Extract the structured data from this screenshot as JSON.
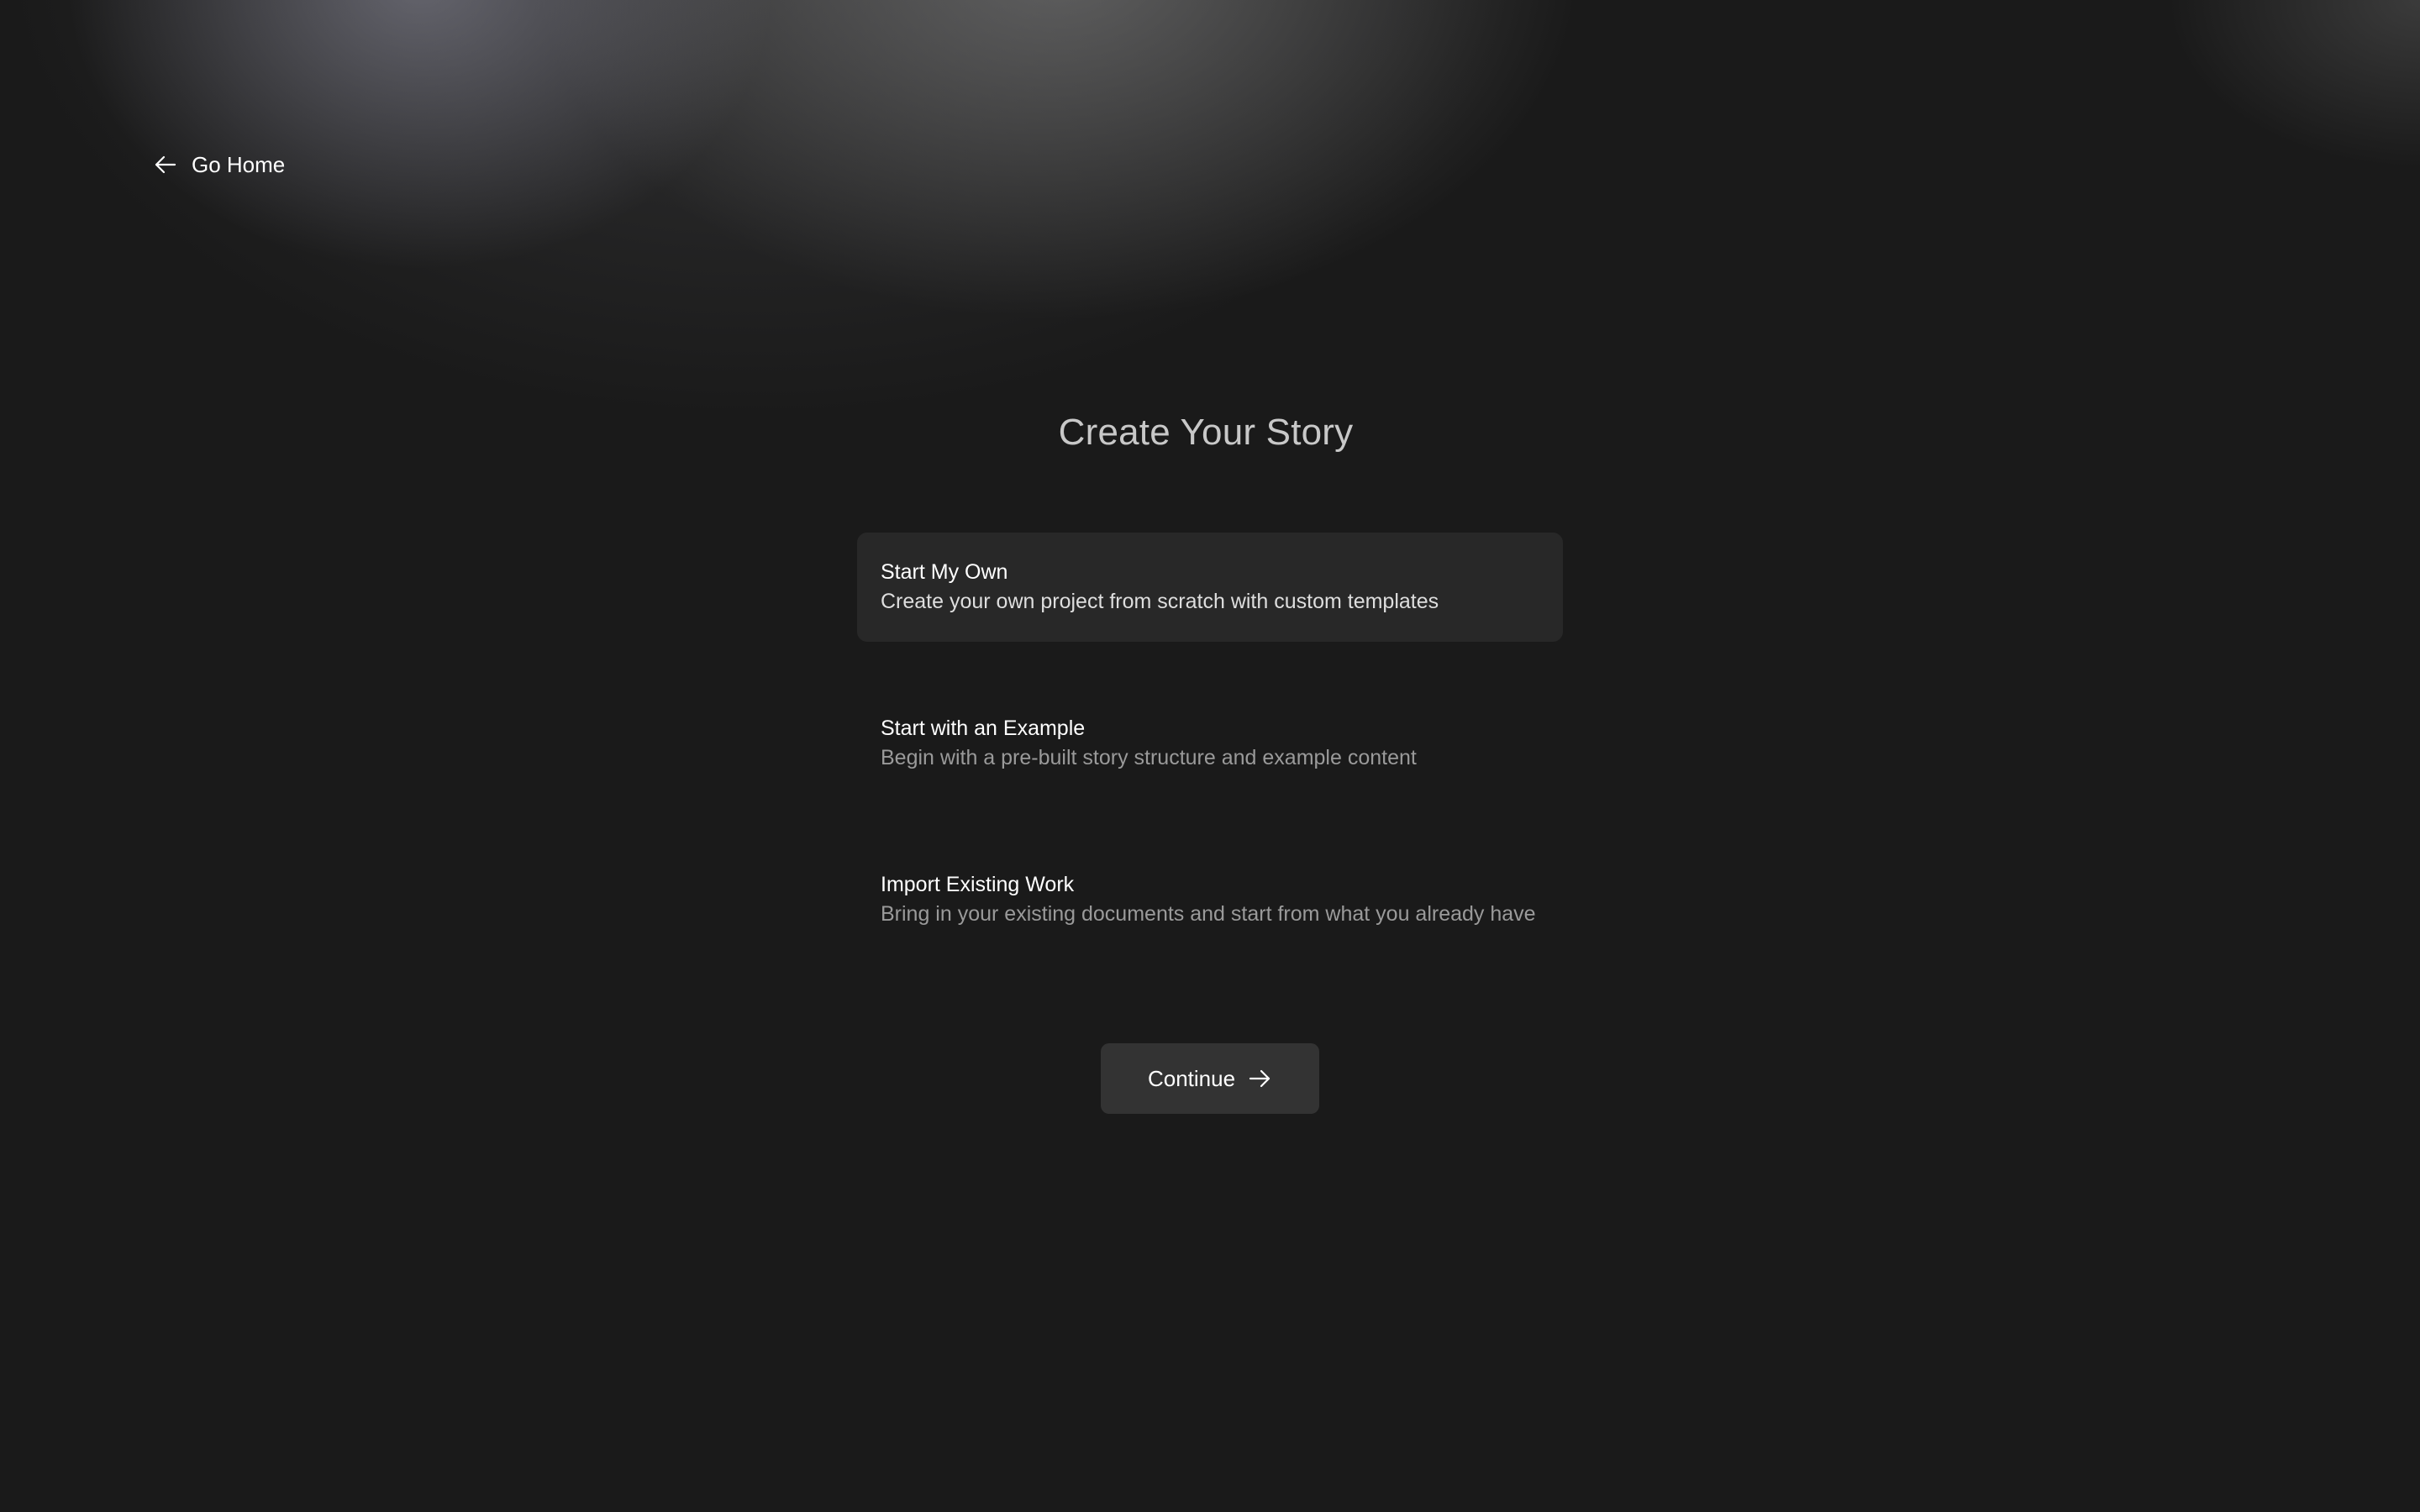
{
  "nav": {
    "back_label": "Go Home",
    "back_icon": "arrow-left-icon"
  },
  "page": {
    "title": "Create Your Story"
  },
  "options": [
    {
      "title": "Start My Own",
      "description": "Create your own project from scratch with custom templates",
      "selected": true
    },
    {
      "title": "Start with an Example",
      "description": "Begin with a pre-built story structure and example content",
      "selected": false
    },
    {
      "title": "Import Existing Work",
      "description": "Bring in your existing documents and start from what you already have",
      "selected": false
    }
  ],
  "actions": {
    "continue_label": "Continue",
    "continue_icon": "arrow-right-icon"
  },
  "colors": {
    "background": "#1a1a1a",
    "selected_card": "#282828",
    "button": "#333333",
    "muted_text": "#9a9a9a"
  }
}
